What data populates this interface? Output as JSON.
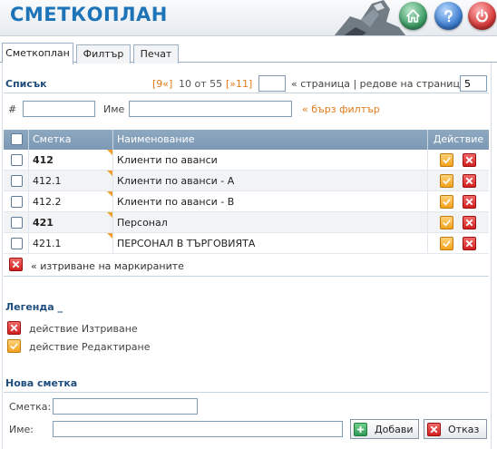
{
  "header": {
    "app_title": "СМЕТКОПЛАН",
    "buttons": [
      {
        "name": "home-icon"
      },
      {
        "name": "help-icon"
      },
      {
        "name": "power-icon"
      }
    ]
  },
  "tabs": [
    {
      "label": "Сметкоплан",
      "active": true
    },
    {
      "label": "Филтър",
      "active": false
    },
    {
      "label": "Печат",
      "active": false
    }
  ],
  "list": {
    "title": "Списък",
    "pager": {
      "first": "[9«]",
      "range": "10 от 55",
      "last": "[»11]",
      "page_input": "",
      "page_label": "« страница | редове на страница »",
      "rows_per_page": "5"
    },
    "filter": {
      "number_label": "#",
      "number_value": "",
      "name_label": "Име",
      "name_value": "",
      "quick_filter": "« бърз филтър"
    },
    "columns": [
      "Сметка",
      "Наименование",
      "Действие"
    ],
    "rows": [
      {
        "account": "412",
        "name": "Клиенти по аванси",
        "bold": true
      },
      {
        "account": "412.1",
        "name": "Клиенти по аванси - А",
        "bold": false
      },
      {
        "account": "412.2",
        "name": "Клиенти по аванси - В",
        "bold": false
      },
      {
        "account": "421",
        "name": "Персонал",
        "bold": true
      },
      {
        "account": "421.1",
        "name": "ПЕРСОНАЛ В ТЪРГОВИЯТА",
        "bold": false
      }
    ],
    "delete_marked": "« изтриване на маркираните"
  },
  "legend": {
    "title": "Легенда _",
    "items": [
      {
        "icon": "delete-icon",
        "text": "действие Изтриване"
      },
      {
        "icon": "edit-icon",
        "text": "действие Редактиране"
      }
    ]
  },
  "new_account": {
    "title": "Нова сметка",
    "account_label": "Сметка:",
    "account_value": "",
    "name_label": "Име:",
    "name_value": "",
    "add_button": "Добави",
    "cancel_button": "Отказ"
  },
  "colors": {
    "brand": "#1d74b8",
    "section_title": "#1f4e7c",
    "accent_orange": "#e07a1a",
    "table_header": "#8ea8c0",
    "delete_red": "#d11f1f",
    "edit_orange": "#f3a21a"
  }
}
